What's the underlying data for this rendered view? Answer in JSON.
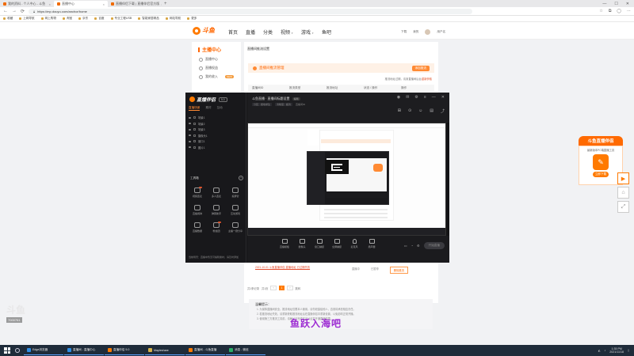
{
  "browser": {
    "tabs": [
      {
        "label": "我的资料 - 个人中心 - 斗鱼"
      },
      {
        "label": "直播中心"
      },
      {
        "label": "直播伴侣下载 | 直播伴侣官方版"
      }
    ],
    "url": "https://mp.douyu.com/anchor/home",
    "bookmarks": [
      "收藏",
      "上网导航",
      "网上购物",
      "淘宝",
      "京东",
      "百度",
      "专业工程USB",
      "智能家居精品",
      "网站导航",
      "更多"
    ]
  },
  "site": {
    "logo": "斗鱼",
    "nav": [
      "首页",
      "直播",
      "分类",
      "视频",
      "游戏",
      "鱼吧"
    ],
    "header_right": [
      "下载",
      "我的",
      "用户名"
    ]
  },
  "sidebar": {
    "title": "主播中心",
    "items": [
      {
        "label": "直播中心"
      },
      {
        "label": "直播权益"
      },
      {
        "label": "我的收入",
        "badge": "NEW"
      }
    ]
  },
  "main": {
    "breadcrumb": "直播间推流设置",
    "banner": "直播间推流管理",
    "banner_btn": "添加推流",
    "hint_pre": "推流地址过期，请到直播间后台",
    "hint_link": "重新获取",
    "table_headers": [
      "直播间ID",
      "推流类型",
      "推流地址",
      "状态 / 操作",
      "操作"
    ],
    "notice_link": "2021-10-01 斗鱼直播伴侣 直播地址 已过期失效",
    "row_buttons": [
      "直播中",
      "已暂停",
      "删除推流"
    ],
    "pager": {
      "total": "共1条记录",
      "per_page": "共1页",
      "goto": "跳转",
      "current": "1"
    },
    "faq_title": "温馨提示：",
    "faq_lines": [
      "1. 为保障直播间安全，推流地址仅限本人使用，请勿泄露给他人，否则将承担相应责任。",
      "2. 若推流地址失效，请重新获取推流地址后在直播伴侣中重新设置，以免影响正常开播。",
      "3. 使用第三方推流工具前，请确认已完成实名认证并开通直播权限。"
    ],
    "subtitle": "鱼跃入海吧"
  },
  "watermark": {
    "text": "斗鱼",
    "number": "7000761"
  },
  "ad": {
    "title": "斗鱼直播伴侣",
    "desc": "最新版本PC端直播工具",
    "btn": "立即下载"
  },
  "app": {
    "name": "直播伴侣",
    "version": "5.0",
    "tabs": [
      "直播场景",
      "素材",
      "互动"
    ],
    "scenes": [
      "场景1",
      "场景2",
      "场景3",
      "摄像头1",
      "窗口1",
      "图片1"
    ],
    "tools_title": "工具箱",
    "tools": [
      "视频连麦",
      "多人连麦",
      "投屏管",
      "直播闹钟",
      "弹幕助手",
      "互动游戏",
      "直播数据",
      "粉丝团",
      "主播一键分享"
    ],
    "footer": "当前场景：直播中暂无可编辑素材，请及时添加",
    "title": "斗鱼直播 · 直播间标题设置",
    "title_tag": "编辑",
    "sub": [
      "分区：绝地求生",
      "清晰度：超清",
      "直播间ID"
    ],
    "controls": [
      "直播模板",
      "摄像头",
      "窗口捕捉",
      "全屏捕捉",
      "麦克风",
      "扬声器"
    ],
    "start_btn": "开始直播"
  },
  "taskbar": {
    "items": [
      "Edge浏览器",
      "直播间 - 直播中心",
      "直播伴侣 5.0",
      "Mapleshare",
      "直播间 - 斗鱼直播",
      "消息 - 微信"
    ],
    "time": "1:35 PM",
    "date": "2021/11/18"
  }
}
